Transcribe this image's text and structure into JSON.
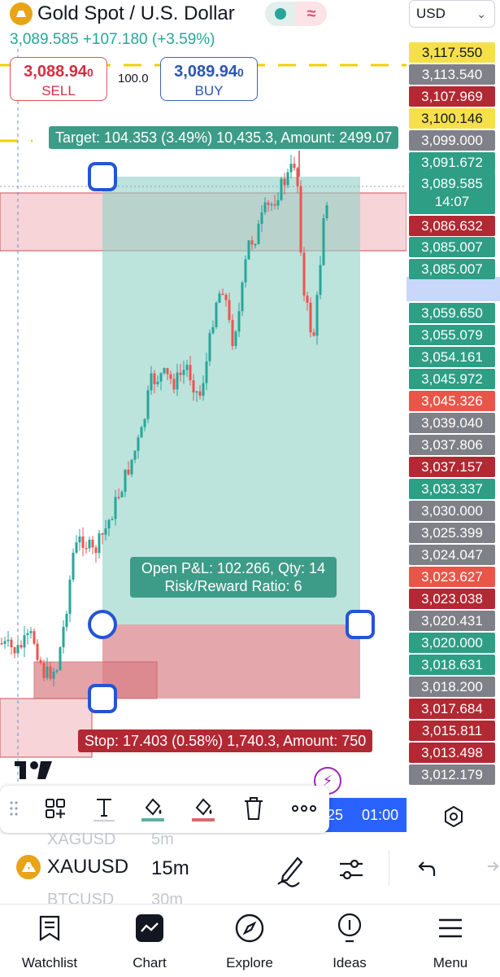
{
  "header": {
    "title": "Gold Spot / U.S. Dollar",
    "last_price": "3,089.585",
    "change": "+107.180 (+3.59%)",
    "currency": "USD"
  },
  "trade": {
    "sell_price_main": "3,088.94",
    "sell_price_small": "0",
    "sell_label": "SELL",
    "buy_price_main": "3,089.94",
    "buy_price_small": "0",
    "buy_label": "BUY",
    "quantity": "100.0"
  },
  "position": {
    "target_text": "Target: 104.353 (3.49%) 10,435.3, Amount: 2499.07",
    "stop_text": "Stop: 17.403 (0.58%) 1,740.3, Amount: 750",
    "pnl_line1": "Open P&L: 102.266, Qty: 14",
    "pnl_line2": "Risk/Reward Ratio: 6"
  },
  "price_scale": [
    {
      "value": "3,117.550",
      "bg": "#f5e04a",
      "fg": "#131722"
    },
    {
      "value": "3,113.540",
      "bg": "#7e8288",
      "fg": "#ffffff"
    },
    {
      "value": "3,107.969",
      "bg": "#b22833",
      "fg": "#ffffff"
    },
    {
      "value": "3,100.146",
      "bg": "#f5e04a",
      "fg": "#131722"
    },
    {
      "value": "3,099.000",
      "bg": "#7e8288",
      "fg": "#ffffff"
    },
    {
      "value": "3,091.672",
      "bg": "#2e9e85",
      "fg": "#ffffff"
    },
    {
      "value": "3,085.007",
      "bg": "#2e9e85",
      "fg": "#ffffff"
    },
    {
      "value": "3,085.007",
      "bg": "#2e9e85",
      "fg": "#ffffff"
    },
    {
      "value": "3,059.650",
      "bg": "#2e9e85",
      "fg": "#ffffff"
    },
    {
      "value": "3,055.079",
      "bg": "#2e9e85",
      "fg": "#ffffff"
    },
    {
      "value": "3,054.161",
      "bg": "#2e9e85",
      "fg": "#ffffff"
    },
    {
      "value": "3,045.972",
      "bg": "#2e9e85",
      "fg": "#ffffff"
    },
    {
      "value": "3,045.326",
      "bg": "#e85648",
      "fg": "#ffffff"
    },
    {
      "value": "3,039.040",
      "bg": "#7e8288",
      "fg": "#ffffff"
    },
    {
      "value": "3,037.806",
      "bg": "#7e8288",
      "fg": "#ffffff"
    },
    {
      "value": "3,037.157",
      "bg": "#b22833",
      "fg": "#ffffff"
    },
    {
      "value": "3,033.337",
      "bg": "#2e9e85",
      "fg": "#ffffff"
    },
    {
      "value": "3,030.000",
      "bg": "#7e8288",
      "fg": "#ffffff"
    },
    {
      "value": "3,025.399",
      "bg": "#7e8288",
      "fg": "#ffffff"
    },
    {
      "value": "3,024.047",
      "bg": "#7e8288",
      "fg": "#ffffff"
    },
    {
      "value": "3,023.627",
      "bg": "#e85648",
      "fg": "#ffffff"
    },
    {
      "value": "3,023.038",
      "bg": "#b22833",
      "fg": "#ffffff"
    },
    {
      "value": "3,020.431",
      "bg": "#7e8288",
      "fg": "#ffffff"
    },
    {
      "value": "3,020.000",
      "bg": "#2e9e85",
      "fg": "#ffffff"
    },
    {
      "value": "3,018.631",
      "bg": "#2e9e85",
      "fg": "#ffffff"
    },
    {
      "value": "3,018.200",
      "bg": "#7e8288",
      "fg": "#ffffff"
    },
    {
      "value": "3,017.684",
      "bg": "#b22833",
      "fg": "#ffffff"
    },
    {
      "value": "3,015.811",
      "bg": "#b22833",
      "fg": "#ffffff"
    },
    {
      "value": "3,013.498",
      "bg": "#b22833",
      "fg": "#ffffff"
    },
    {
      "value": "3,012.179",
      "bg": "#7e8288",
      "fg": "#ffffff"
    }
  ],
  "current_price": {
    "value": "3,089.585",
    "countdown": "14:07",
    "bid": "3,086.632"
  },
  "time_axis": {
    "date_fragment": "25",
    "time": "01:00"
  },
  "symbols": {
    "prev_symbol": "XAGUSD",
    "prev_interval": "5m",
    "symbol": "XAUUSD",
    "interval": "15m",
    "next_symbol": "BTCUSD",
    "next_interval": "30m"
  },
  "nav": [
    {
      "label": "Watchlist",
      "icon": "watchlist-icon"
    },
    {
      "label": "Chart",
      "icon": "chart-icon"
    },
    {
      "label": "Explore",
      "icon": "explore-icon"
    },
    {
      "label": "Ideas",
      "icon": "ideas-icon"
    },
    {
      "label": "Menu",
      "icon": "menu-icon"
    }
  ],
  "colors": {
    "up": "#26a69a",
    "down": "#ef5350",
    "accent": "#2962ff",
    "target_zone": "#8fd1c4",
    "stop_zone": "#d46a6f"
  }
}
